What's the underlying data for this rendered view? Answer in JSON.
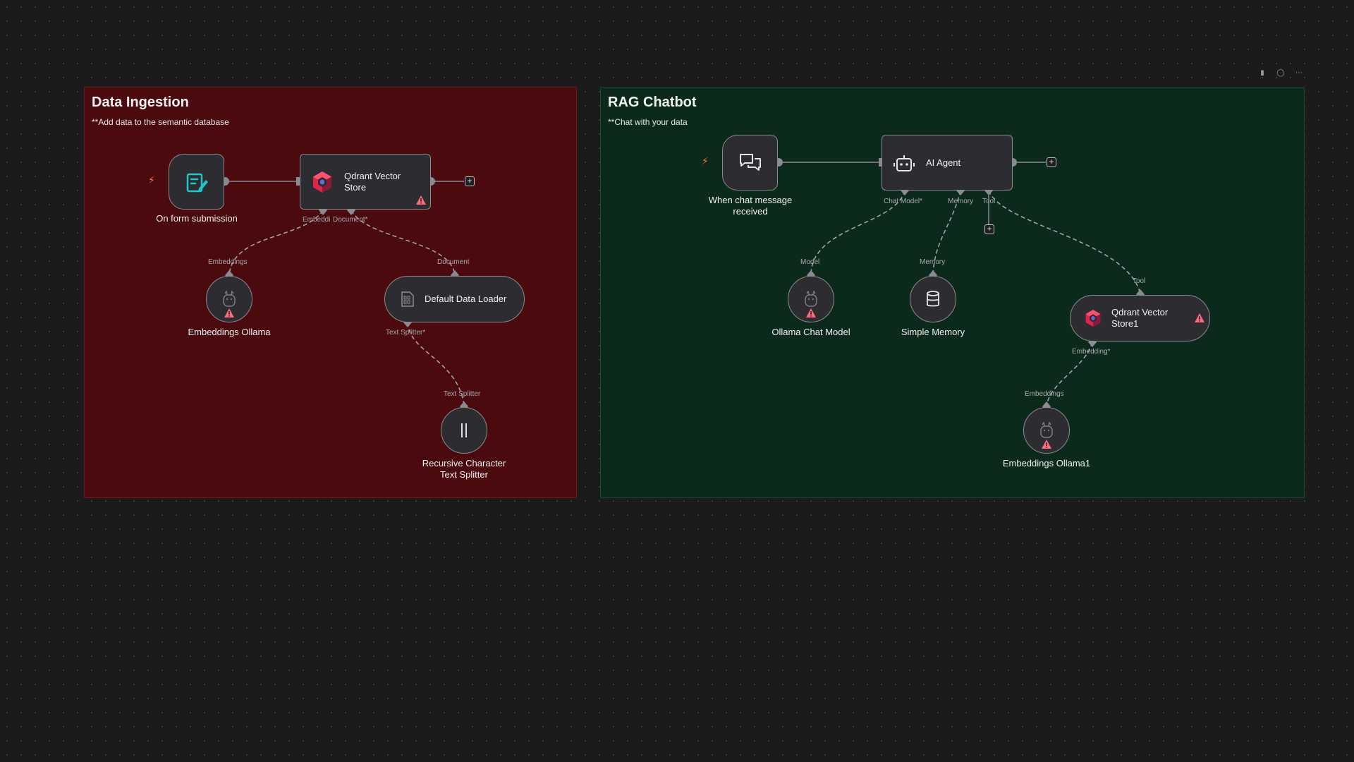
{
  "groups": {
    "ingestion": {
      "title": "Data Ingestion",
      "subtitle": "**Add data to the semantic database"
    },
    "chatbot": {
      "title": "RAG Chatbot",
      "subtitle": "**Chat with your data"
    }
  },
  "nodes": {
    "form_trigger": {
      "label": "On form submission",
      "icon": "form-icon"
    },
    "qdrant_store": {
      "label_line1": "Qdrant Vector",
      "label_line2": "Store",
      "icon": "qdrant-icon"
    },
    "embeddings_ollama": {
      "label": "Embeddings Ollama",
      "icon": "ollama-icon"
    },
    "default_loader": {
      "label": "Default Data Loader",
      "icon": "document-icon"
    },
    "text_splitter": {
      "label_line1": "Recursive Character",
      "label_line2": "Text Splitter",
      "icon": "splitter-icon"
    },
    "chat_trigger": {
      "label_line1": "When chat message",
      "label_line2": "received",
      "icon": "chat-icon"
    },
    "ai_agent": {
      "label": "AI Agent",
      "icon": "robot-icon"
    },
    "ollama_chat": {
      "label": "Ollama Chat Model",
      "icon": "ollama-icon"
    },
    "simple_memory": {
      "label": "Simple Memory",
      "icon": "database-icon"
    },
    "qdrant_store1": {
      "label_line1": "Qdrant Vector",
      "label_line2": "Store1",
      "icon": "qdrant-icon"
    },
    "embeddings_ollama1": {
      "label": "Embeddings Ollama1",
      "icon": "ollama-icon"
    }
  },
  "ports": {
    "qdrant_embeddi": "Embeddi",
    "qdrant_document": "Document*",
    "emb_embeddings": "Embeddings",
    "loader_document": "Document",
    "loader_text_splitter": "Text Splitter*",
    "splitter_text_splitter": "Text Splitter",
    "agent_chat_model": "Chat Model*",
    "agent_memory": "Memory",
    "agent_tool": "Tool",
    "ollama_model": "Model",
    "memory_memory": "Memory",
    "qdrant1_tool": "Tool",
    "qdrant1_embedding": "Embedding*",
    "emb1_embeddings": "Embeddings"
  },
  "colors": {
    "canvas": "#1b1b1b",
    "ingestion_bg": "#4b0a0d",
    "chatbot_bg": "#0c2a1c",
    "node_bg": "#2c2c31",
    "node_border": "#8a8a90",
    "warning": "#ff6b7a",
    "trigger_bolt": "#ff6b4a"
  },
  "toolbar": {
    "icons": [
      "trash-icon",
      "settings-icon",
      "more-icon"
    ]
  }
}
